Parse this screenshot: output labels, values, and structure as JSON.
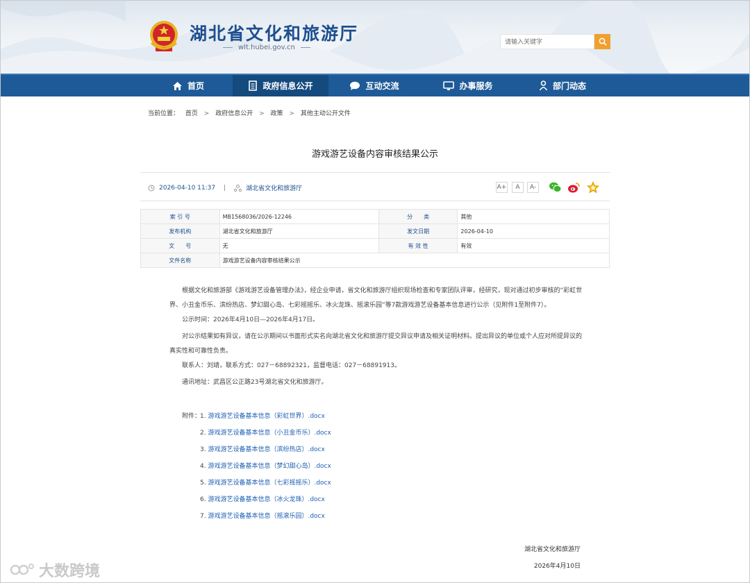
{
  "header": {
    "site_title": "湖北省文化和旅游厅",
    "site_url": "wlt.hubei.gov.cn",
    "search_placeholder": "请输入关键字",
    "icons": {
      "emblem": "national-emblem-icon",
      "search": "search-icon"
    }
  },
  "nav": [
    {
      "label": "首页",
      "icon": "home-icon"
    },
    {
      "label": "政府信息公开",
      "icon": "document-icon"
    },
    {
      "label": "互动交流",
      "icon": "chat-bubble-icon"
    },
    {
      "label": "办事服务",
      "icon": "monitor-icon"
    },
    {
      "label": "部门动态",
      "icon": "person-icon"
    }
  ],
  "breadcrumb": {
    "prefix": "当前位置：",
    "items": [
      "首页",
      "政府信息公开",
      "政策",
      "其他主动公开文件"
    ],
    "separator": ">"
  },
  "article": {
    "title": "游戏游艺设备内容审核结果公示",
    "datetime": "2026-04-10 11:37",
    "source": "湖北省文化和旅游厅",
    "font_sizes": [
      "A+",
      "A",
      "A-"
    ],
    "share_icons": [
      "wechat-icon",
      "weibo-icon",
      "favorite-star-icon"
    ]
  },
  "info_table": [
    [
      {
        "k": "索 引 号",
        "v": "MB1568036/2026-12246"
      },
      {
        "k": "分　　类",
        "v": "其他"
      }
    ],
    [
      {
        "k": "发布机构",
        "v": "湖北省文化和旅游厅"
      },
      {
        "k": "发文日期",
        "v": "2026-04-10"
      }
    ],
    [
      {
        "k": "文　　号",
        "v": "无"
      },
      {
        "k": "有 效 性",
        "v": "有效"
      }
    ],
    [
      {
        "k": "文件名称",
        "v": "游戏游艺设备内容审核结果公示"
      }
    ]
  ],
  "body": {
    "p1": "根据文化和旅游部《游戏游艺设备管理办法》，经企业申请，省文化和旅游厅组织现场检查和专家团队评审，经研究，现对通过初步审核的“彩虹世界、小丑金币乐、滨纷热店、梦幻甜心岛、七彩摇摇乐、冰火龙珠、摇滚乐园”等7款游戏游艺设备基本信息进行公示（见附件1至附件7）。",
    "p2": "公示时间：2026年4月10日—2026年4月17日。",
    "p3": "对公示结果如有异议，请在公示期间以书面形式实名向湖北省文化和旅游厅提交异议申请及相关证明材料。提出异议的单位或个人应对所提异议的真实性和可靠性负责。",
    "p4": "联系人：刘靖，联系方式：027－68892321，监督电话：027－68891913。",
    "p5": "通讯地址：武昌区公正路23号湖北省文化和旅游厅。"
  },
  "attachments": {
    "label": "附件：",
    "items": [
      {
        "num": "1.",
        "name": "游戏游艺设备基本信息（彩虹世界）.docx"
      },
      {
        "num": "2.",
        "name": "游戏游艺设备基本信息（小丑金币乐）.docx"
      },
      {
        "num": "3.",
        "name": "游戏游艺设备基本信息（滨纷热店）.docx"
      },
      {
        "num": "4.",
        "name": "游戏游艺设备基本信息（梦幻甜心岛）.docx"
      },
      {
        "num": "5.",
        "name": "游戏游艺设备基本信息（七彩摇摇乐）.docx"
      },
      {
        "num": "6.",
        "name": "游戏游艺设备基本信息（冰火龙珠）.docx"
      },
      {
        "num": "7.",
        "name": "游戏游艺设备基本信息（摇滚乐园）.docx"
      }
    ]
  },
  "signature": {
    "org": "湖北省文化和旅游厅",
    "date": "2026年4月10日"
  },
  "watermark": {
    "text": "大数跨境",
    "icon": "watermark-logo-icon"
  },
  "colors": {
    "nav_bg": "#1e5a97",
    "nav_active": "#144a7e",
    "link": "#1d5fb3",
    "search_button": "#f0a030",
    "title_blue": "#1d4f8f"
  }
}
